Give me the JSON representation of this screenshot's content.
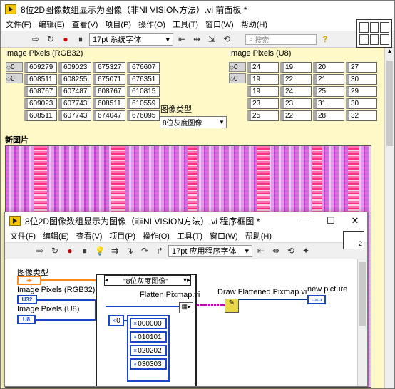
{
  "front_window": {
    "title": "8位2D图像数组显示为图像（非NI VISION方法）.vi 前面板 *",
    "menu": [
      "文件(F)",
      "编辑(E)",
      "查看(V)",
      "项目(P)",
      "操作(O)",
      "工具(T)",
      "窗口(W)",
      "帮助(H)"
    ],
    "search_placeholder": "搜索",
    "font": "17pt 系统字体",
    "panel": {
      "rgb_label": "Image Pixels (RGB32)",
      "rgb_index": [
        "0",
        "0"
      ],
      "rgb_values": [
        [
          "609279",
          "609023",
          "675327",
          "676607"
        ],
        [
          "608511",
          "608255",
          "675071",
          "676351"
        ],
        [
          "608767",
          "607487",
          "608767",
          "610815"
        ],
        [
          "609023",
          "607743",
          "608511",
          "610559"
        ],
        [
          "608511",
          "607743",
          "674047",
          "676095"
        ]
      ],
      "u8_label": "Image Pixels (U8)",
      "u8_index": [
        "0",
        "0"
      ],
      "u8_values": [
        [
          "24",
          "19",
          "20",
          "27"
        ],
        [
          "19",
          "22",
          "21",
          "30"
        ],
        [
          "19",
          "24",
          "25",
          "29"
        ],
        [
          "23",
          "23",
          "31",
          "30"
        ],
        [
          "25",
          "22",
          "28",
          "32"
        ]
      ],
      "type_label": "图像类型",
      "type_value": "8位灰度图像",
      "image_label": "新图片"
    }
  },
  "block_window": {
    "title": "8位2D图像数组显示为图像（非NI VISION方法）.vi 程序框图 *",
    "menu": [
      "文件(F)",
      "编辑(E)",
      "查看(V)",
      "项目(P)",
      "操作(O)",
      "工具(T)",
      "窗口(W)",
      "帮助(H)"
    ],
    "font": "17pt 应用程序字体",
    "diagram": {
      "type_label": "图像类型",
      "rgb_label": "Image Pixels (RGB32)",
      "u8_label": "Image Pixels (U8)",
      "case_selector": "\"8位灰度图像\"",
      "flatten_label": "Flatten Pixmap.vi",
      "draw_label": "Draw Flattened Pixmap.vi",
      "new_picture_label": "new picture",
      "const_index": "0",
      "colors": [
        "000000",
        "010101",
        "020202",
        "030303"
      ],
      "term_u32": "U32",
      "term_u8": "U8"
    }
  }
}
